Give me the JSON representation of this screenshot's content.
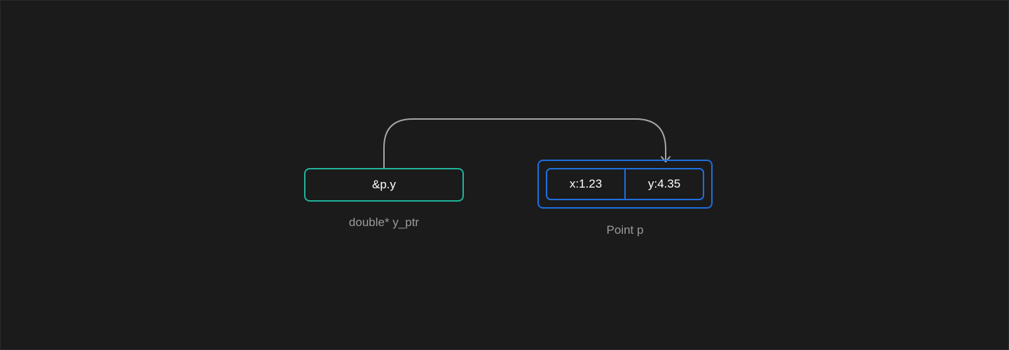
{
  "pointer": {
    "value": "&p.y",
    "caption": "double* y_ptr"
  },
  "struct": {
    "caption": "Point p",
    "fields": [
      {
        "label": "x:1.23"
      },
      {
        "label": "y:4.35"
      }
    ]
  },
  "colors": {
    "background": "#1b1b1b",
    "pointer_border": "#20b39a",
    "struct_border": "#1f6fe0",
    "arrow": "#a6a6a6",
    "caption_text": "#9a9a9a",
    "value_text": "#ffffff"
  }
}
